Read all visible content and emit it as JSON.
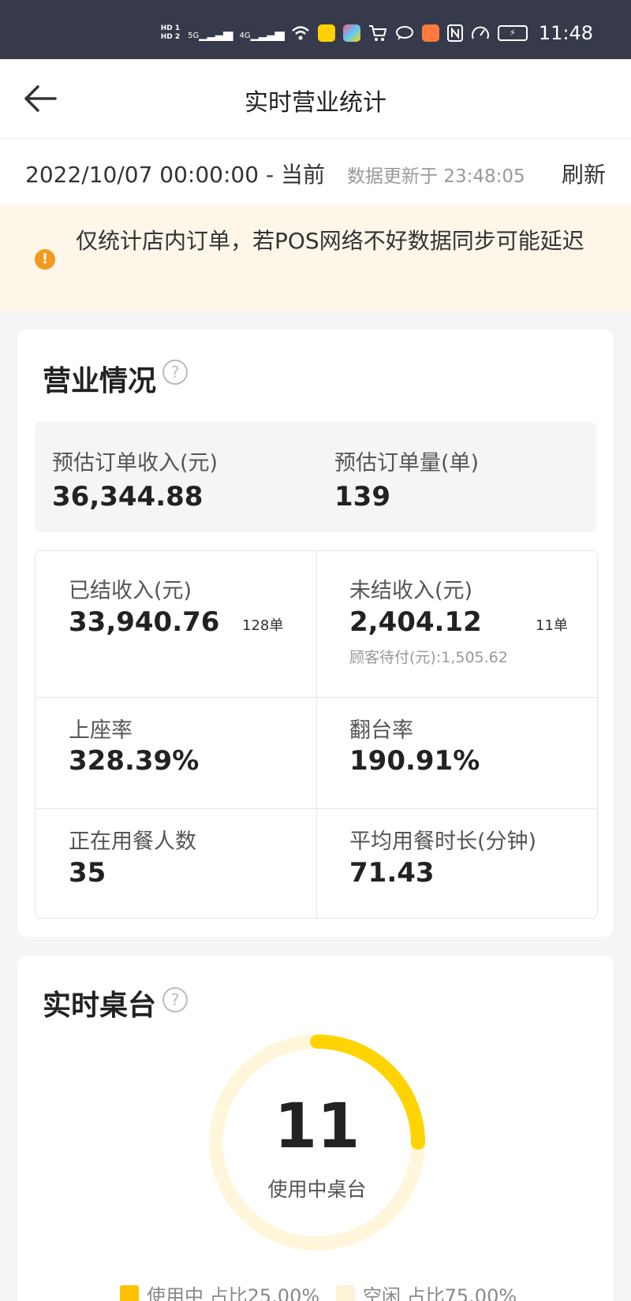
{
  "status_bar": {
    "hd1": "HD 1",
    "hd2": "HD 2",
    "sig1": "5G",
    "sig2": "4G",
    "time": "11:48"
  },
  "nav": {
    "title": "实时营业统计"
  },
  "filter": {
    "date_range": "2022/10/07 00:00:00 - 当前",
    "update_text": "数据更新于 23:48:05",
    "refresh_label": "刷新"
  },
  "notice": {
    "text": "仅统计店内订单，若POS网络不好数据同步可能延迟"
  },
  "business": {
    "title": "营业情况",
    "est_income_label": "预估订单收入(元)",
    "est_income_value": "36,344.88",
    "est_orders_label": "预估订单量(单)",
    "est_orders_value": "139",
    "settled_label": "已结收入(元)",
    "settled_value": "33,940.76",
    "settled_count": "128单",
    "unsettled_label": "未结收入(元)",
    "unsettled_value": "2,404.12",
    "unsettled_count": "11单",
    "unsettled_sub": "顾客待付(元):1,505.62",
    "seat_rate_label": "上座率",
    "seat_rate_value": "328.39%",
    "turnover_label": "翻台率",
    "turnover_value": "190.91%",
    "dining_people_label": "正在用餐人数",
    "dining_people_value": "35",
    "avg_duration_label": "平均用餐时长(分钟)",
    "avg_duration_value": "71.43"
  },
  "tables": {
    "title": "实时桌台",
    "in_use_count": "11",
    "in_use_label": "使用中桌台",
    "in_use_fraction": 0.25,
    "legend_in_use": "使用中 占比25.00%",
    "legend_idle": "空闲 占比75.00%"
  },
  "colors": {
    "accent": "#ffd400",
    "ring_track": "#fff6dc",
    "notice_bg": "#fff6ea",
    "warning": "#f39a1e",
    "legend_in_use": "#ffc000",
    "legend_idle": "#fdf1d6"
  }
}
